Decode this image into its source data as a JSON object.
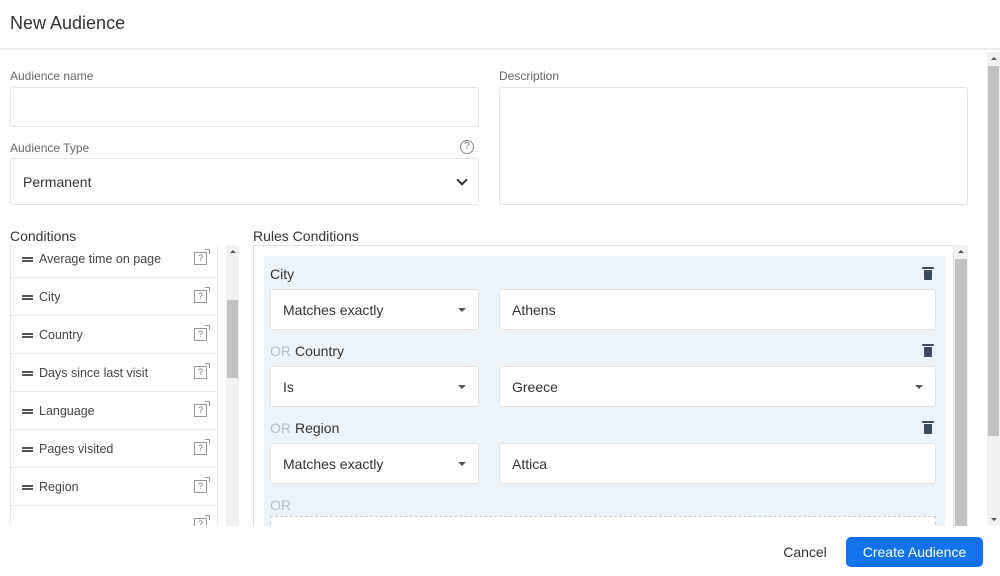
{
  "modal": {
    "title": "New Audience"
  },
  "form": {
    "audience_name": {
      "label": "Audience name",
      "value": ""
    },
    "description": {
      "label": "Description",
      "value": ""
    },
    "audience_type": {
      "label": "Audience Type",
      "value": "Permanent",
      "help_icon": "question-circle-icon"
    }
  },
  "conditions": {
    "title": "Conditions",
    "items": [
      {
        "label": "Average time on page"
      },
      {
        "label": "City"
      },
      {
        "label": "Country"
      },
      {
        "label": "Days since last visit"
      },
      {
        "label": "Language"
      },
      {
        "label": "Pages visited"
      },
      {
        "label": "Region"
      }
    ]
  },
  "rules": {
    "title": "Rules Conditions",
    "or_label": "OR",
    "items": [
      {
        "prefix": "",
        "field": "City",
        "operator": "Matches exactly",
        "value": "Athens",
        "value_is_select": false
      },
      {
        "prefix": "OR",
        "field": "Country",
        "operator": "Is",
        "value": "Greece",
        "value_is_select": true
      },
      {
        "prefix": "OR",
        "field": "Region",
        "operator": "Matches exactly",
        "value": "Attica",
        "value_is_select": false
      }
    ]
  },
  "footer": {
    "cancel_label": "Cancel",
    "create_label": "Create Audience"
  },
  "colors": {
    "primary": "#1273eb",
    "rules_panel_bg": "#edf4f9",
    "trash_icon": "#3f4a5c"
  }
}
